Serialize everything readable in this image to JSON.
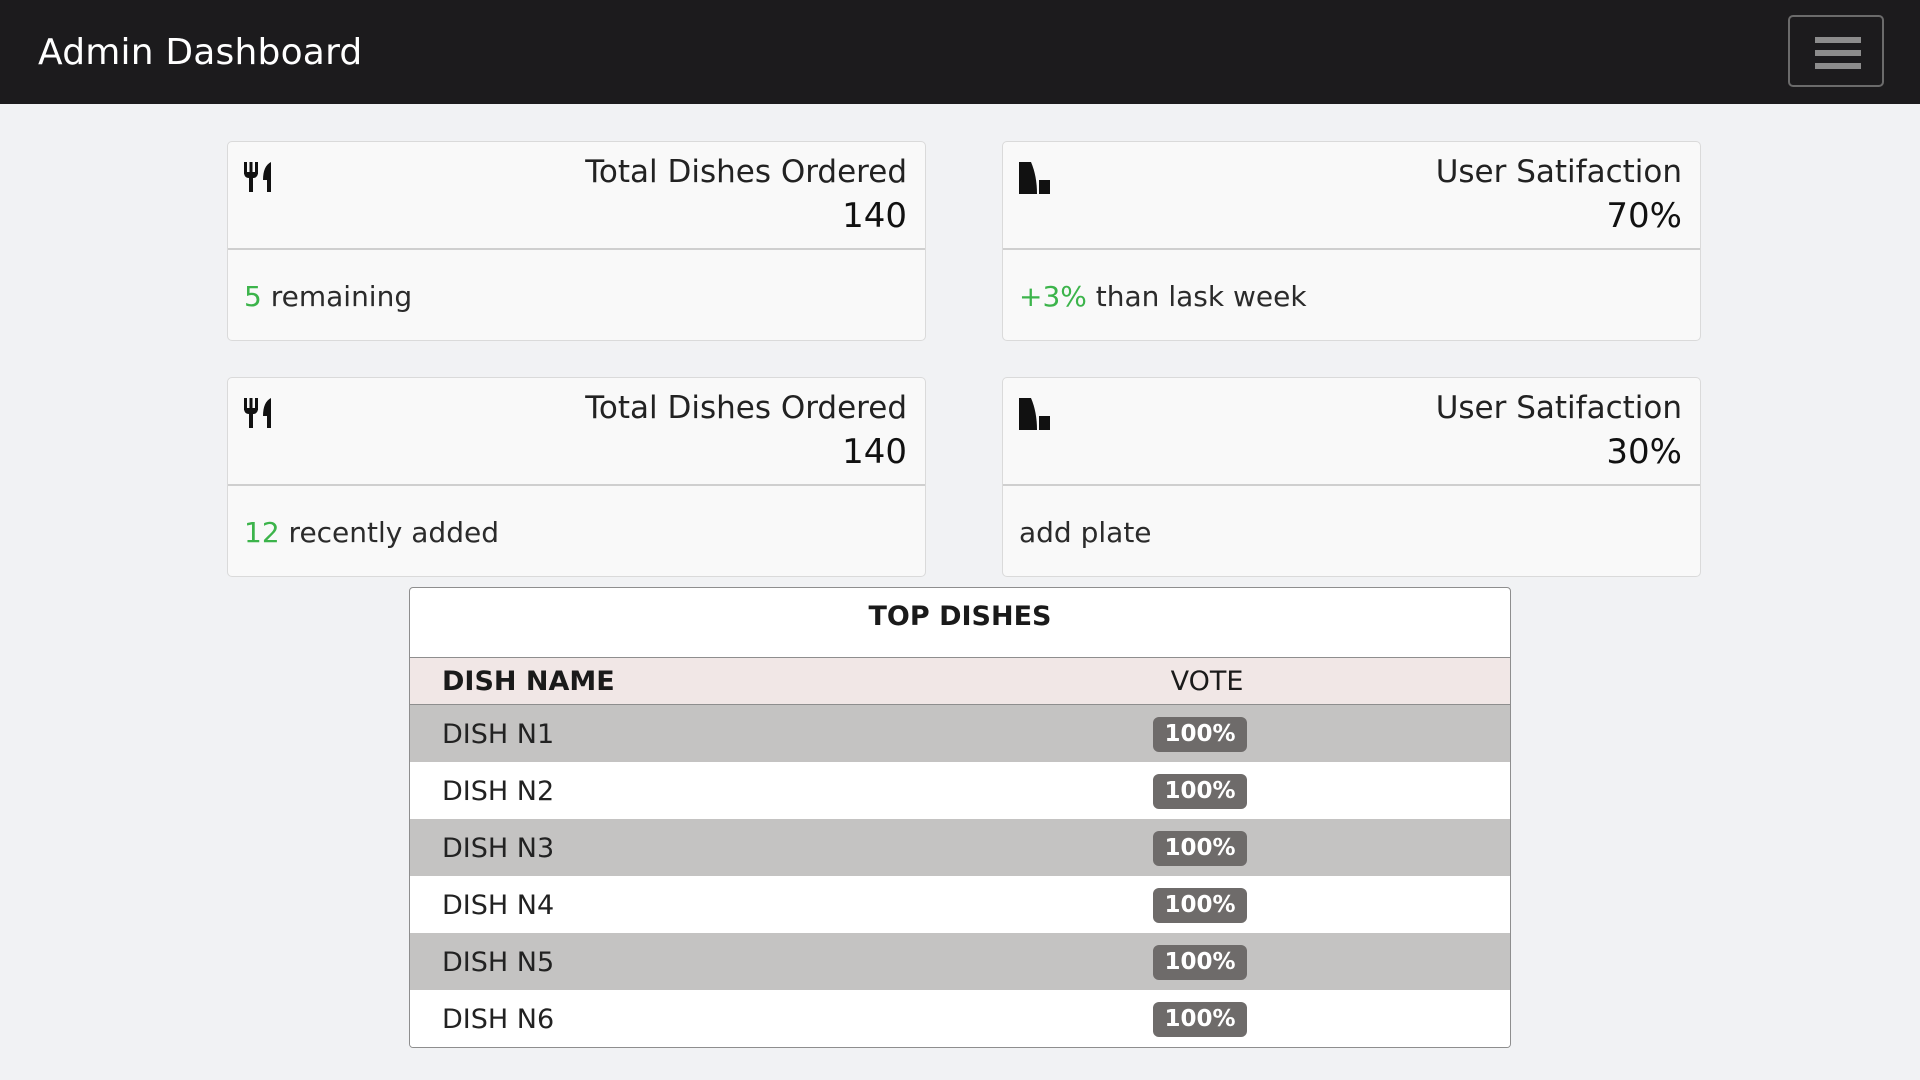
{
  "navbar": {
    "brand": "Admin Dashboard",
    "menu_icon": "hamburger-icon"
  },
  "cards": [
    {
      "icon": "utensils-icon",
      "title": "Total Dishes Ordered",
      "value": "140",
      "footer_accent": "5",
      "footer_text": " remaining"
    },
    {
      "icon": "leaf-chart-icon",
      "title": "User Satifaction",
      "value": "70%",
      "footer_accent": "+3%",
      "footer_text": " than lask week"
    },
    {
      "icon": "utensils-icon",
      "title": "Total Dishes Ordered",
      "value": "140",
      "footer_accent": "12",
      "footer_text": " recently added"
    },
    {
      "icon": "leaf-chart-icon",
      "title": "User Satifaction",
      "value": "30%",
      "footer_accent": "",
      "footer_text": "add plate"
    }
  ],
  "top_dishes": {
    "caption": "TOP DISHES",
    "columns": [
      "DISH NAME",
      "VOTE"
    ],
    "rows": [
      {
        "name": "DISH N1",
        "vote": "100%"
      },
      {
        "name": "DISH N2",
        "vote": "100%"
      },
      {
        "name": "DISH N3",
        "vote": "100%"
      },
      {
        "name": "DISH N4",
        "vote": "100%"
      },
      {
        "name": "DISH N5",
        "vote": "100%"
      },
      {
        "name": "DISH N6",
        "vote": "100%"
      }
    ]
  },
  "colors": {
    "navbar": "#1c1b1d",
    "accent_green": "#3cb44b",
    "badge": "#6e6b6a",
    "header_row": "#f1e7e6",
    "stripe": "#c4c3c2"
  }
}
